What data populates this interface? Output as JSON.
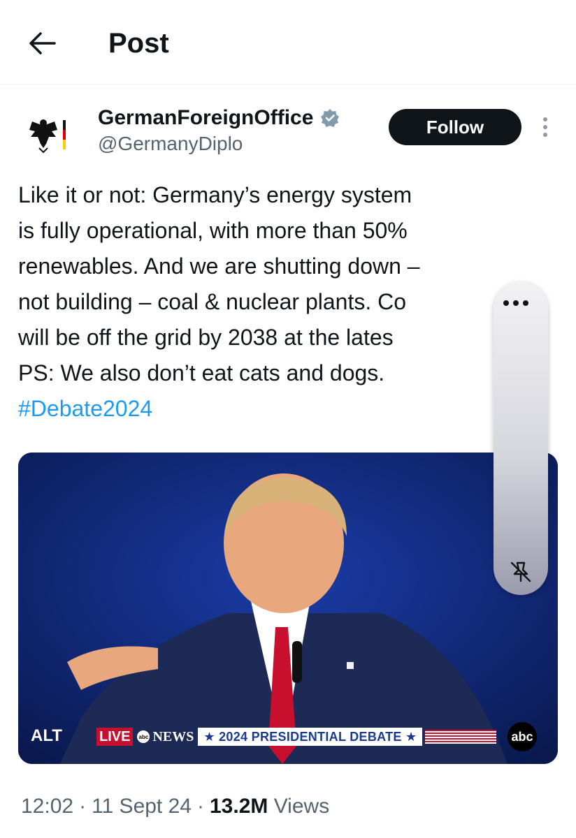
{
  "header": {
    "title": "Post",
    "back_icon": "arrow-left-icon"
  },
  "author": {
    "display_name": "GermanForeignOffice",
    "handle": "@GermanyDiplo",
    "verified_badge": "verified-badge-icon",
    "follow_label": "Follow",
    "more_icon": "more-vertical-icon"
  },
  "post": {
    "lines": [
      "Like it or not: Germany’s energy system",
      "is fully operational, with more than 50%",
      "renewables. And we are shutting down –",
      "not building – coal & nuclear plants. Co",
      "will be off the grid by 2038 at the lates",
      "PS: We also don’t eat cats and dogs."
    ],
    "hashtag": "#Debate2024"
  },
  "media": {
    "alt_label": "ALT",
    "ticker": {
      "live": "LIVE",
      "news": "NEWS",
      "news_logo": "abc",
      "headline": "★ 2024 PRESIDENTIAL DEBATE ★"
    },
    "network_logo": "abc"
  },
  "overlay": {
    "dots_icon": "more-horizontal-icon",
    "pin_icon": "pin-off-icon"
  },
  "meta": {
    "time": "12:02",
    "separator": "·",
    "date": "11 Sept 24",
    "views_count": "13.2M",
    "views_label": "Views"
  },
  "colors": {
    "link": "#1d9bf0",
    "text": "#0f1419",
    "muted": "#536471",
    "follow_bg": "#0f1419",
    "verified": "#829aab"
  }
}
